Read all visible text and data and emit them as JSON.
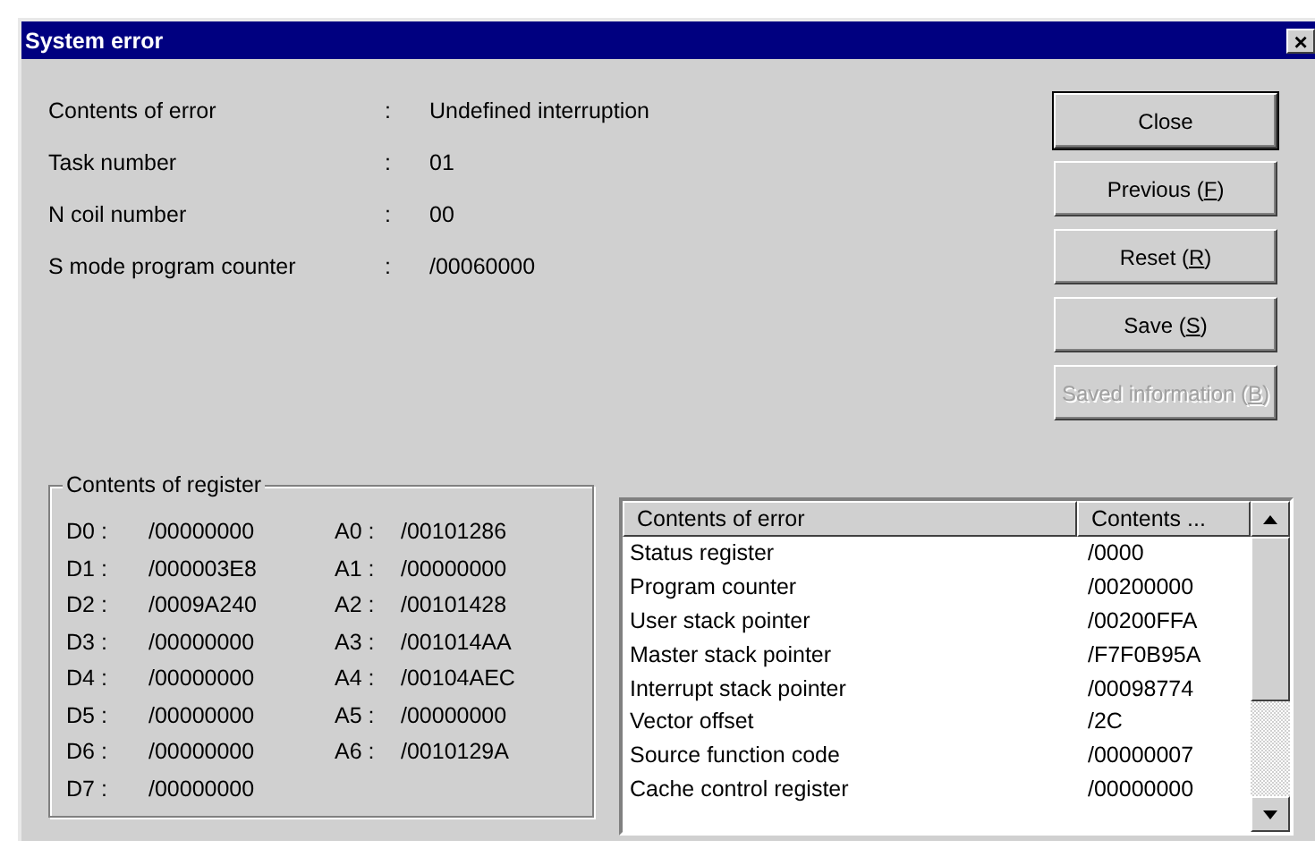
{
  "window": {
    "title": "System error",
    "close": "×"
  },
  "info": [
    {
      "label": "Contents of error",
      "separator": ":",
      "value": "Undefined interruption"
    },
    {
      "label": "Task number",
      "separator": ":",
      "value": "01"
    },
    {
      "label": "N coil number",
      "separator": ":",
      "value": "00"
    },
    {
      "label": "S mode program counter",
      "separator": ":",
      "value": "/00060000"
    }
  ],
  "buttons": [
    {
      "before": "Close",
      "default": true,
      "disabled": false
    },
    {
      "before": "Previous (",
      "key": "F",
      "after": ")",
      "default": false,
      "disabled": false
    },
    {
      "before": "Reset (",
      "key": "R",
      "after": ")",
      "default": false,
      "disabled": false
    },
    {
      "before": "Save (",
      "key": "S",
      "after": ")",
      "default": false,
      "disabled": false
    },
    {
      "before": "Saved information (",
      "key": "B",
      "after": ")",
      "default": false,
      "disabled": true
    }
  ],
  "registers": {
    "title": "Contents of register",
    "rows": [
      {
        "d_name": "D0 :",
        "d_value": "/00000000",
        "a_name": "A0 :",
        "a_value": "/00101286"
      },
      {
        "d_name": "D1 :",
        "d_value": "/000003E8",
        "a_name": "A1 :",
        "a_value": "/00000000"
      },
      {
        "d_name": "D2 :",
        "d_value": "/0009A240",
        "a_name": "A2 :",
        "a_value": "/00101428"
      },
      {
        "d_name": "D3 :",
        "d_value": "/00000000",
        "a_name": "A3 :",
        "a_value": "/001014AA"
      },
      {
        "d_name": "D4 :",
        "d_value": "/00000000",
        "a_name": "A4 :",
        "a_value": "/00104AEC"
      },
      {
        "d_name": "D5 :",
        "d_value": "/00000000",
        "a_name": "A5 :",
        "a_value": "/00000000"
      },
      {
        "d_name": "D6 :",
        "d_value": "/00000000",
        "a_name": "A6 :",
        "a_value": "/0010129A"
      },
      {
        "d_name": "D7 :",
        "d_value": "/00000000"
      }
    ]
  },
  "table": {
    "columns": [
      "Contents of error",
      "Contents ..."
    ],
    "rows": [
      [
        "Status register",
        "/0000"
      ],
      [
        "Program counter",
        "/00200000"
      ],
      [
        "User stack pointer",
        "/00200FFA"
      ],
      [
        "Master stack pointer",
        "/F7F0B95A"
      ],
      [
        "Interrupt stack pointer",
        "/00098774"
      ],
      [
        "Vector offset",
        "/2C"
      ],
      [
        "Source function code",
        "/00000007"
      ],
      [
        "Cache control register",
        "/00000000"
      ]
    ]
  }
}
